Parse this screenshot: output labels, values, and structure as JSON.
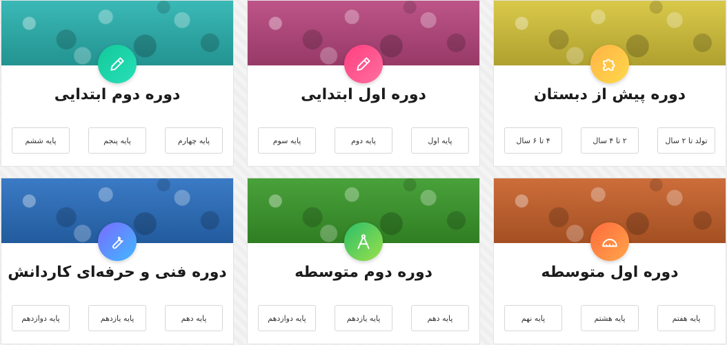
{
  "cards": [
    {
      "title": "دوره پیش از دبستان",
      "icon": "puzzle-icon",
      "banner_color": "#d6c43a",
      "icon_gradient": [
        "#ffb347",
        "#ffd84a"
      ],
      "buttons": [
        "تولد تا ۲ سال",
        "۲ تا ۴ سال",
        "۴ تا ۶ سال"
      ]
    },
    {
      "title": "دوره اول ابتدایی",
      "icon": "pencil-icon",
      "banner_color": "#b8467e",
      "icon_gradient": [
        "#ff3f7f",
        "#ff6fa0"
      ],
      "buttons": [
        "پایه اول",
        "پایه دوم",
        "پایه سوم"
      ]
    },
    {
      "title": "دوره دوم ابتدایی",
      "icon": "pencil-icon",
      "banner_color": "#2ab3b0",
      "icon_gradient": [
        "#12c99a",
        "#28e0b8"
      ],
      "buttons": [
        "پایه چهارم",
        "پایه پنجم",
        "پایه ششم"
      ]
    },
    {
      "title": "دوره اول متوسطه",
      "icon": "ruler-protractor-icon",
      "banner_color": "#c8612a",
      "icon_gradient": [
        "#ff6a3d",
        "#ffa64a"
      ],
      "buttons": [
        "پایه هفتم",
        "پایه هشتم",
        "پایه نهم"
      ]
    },
    {
      "title": "دوره دوم متوسطه",
      "icon": "compass-icon",
      "banner_color": "#3a9a2a",
      "icon_gradient": [
        "#2bbf6a",
        "#9be04a"
      ],
      "buttons": [
        "پایه دهم",
        "پایه یازدهم",
        "پایه دوازدهم"
      ]
    },
    {
      "title": "دوره فنی و حرفه‌ای کاردانش",
      "icon": "wrench-icon",
      "banner_color": "#2a6fc0",
      "icon_gradient": [
        "#7a6bff",
        "#3fb8ff"
      ],
      "buttons": [
        "پایه دهم",
        "پایه یازدهم",
        "پایه دوازدهم"
      ]
    }
  ]
}
